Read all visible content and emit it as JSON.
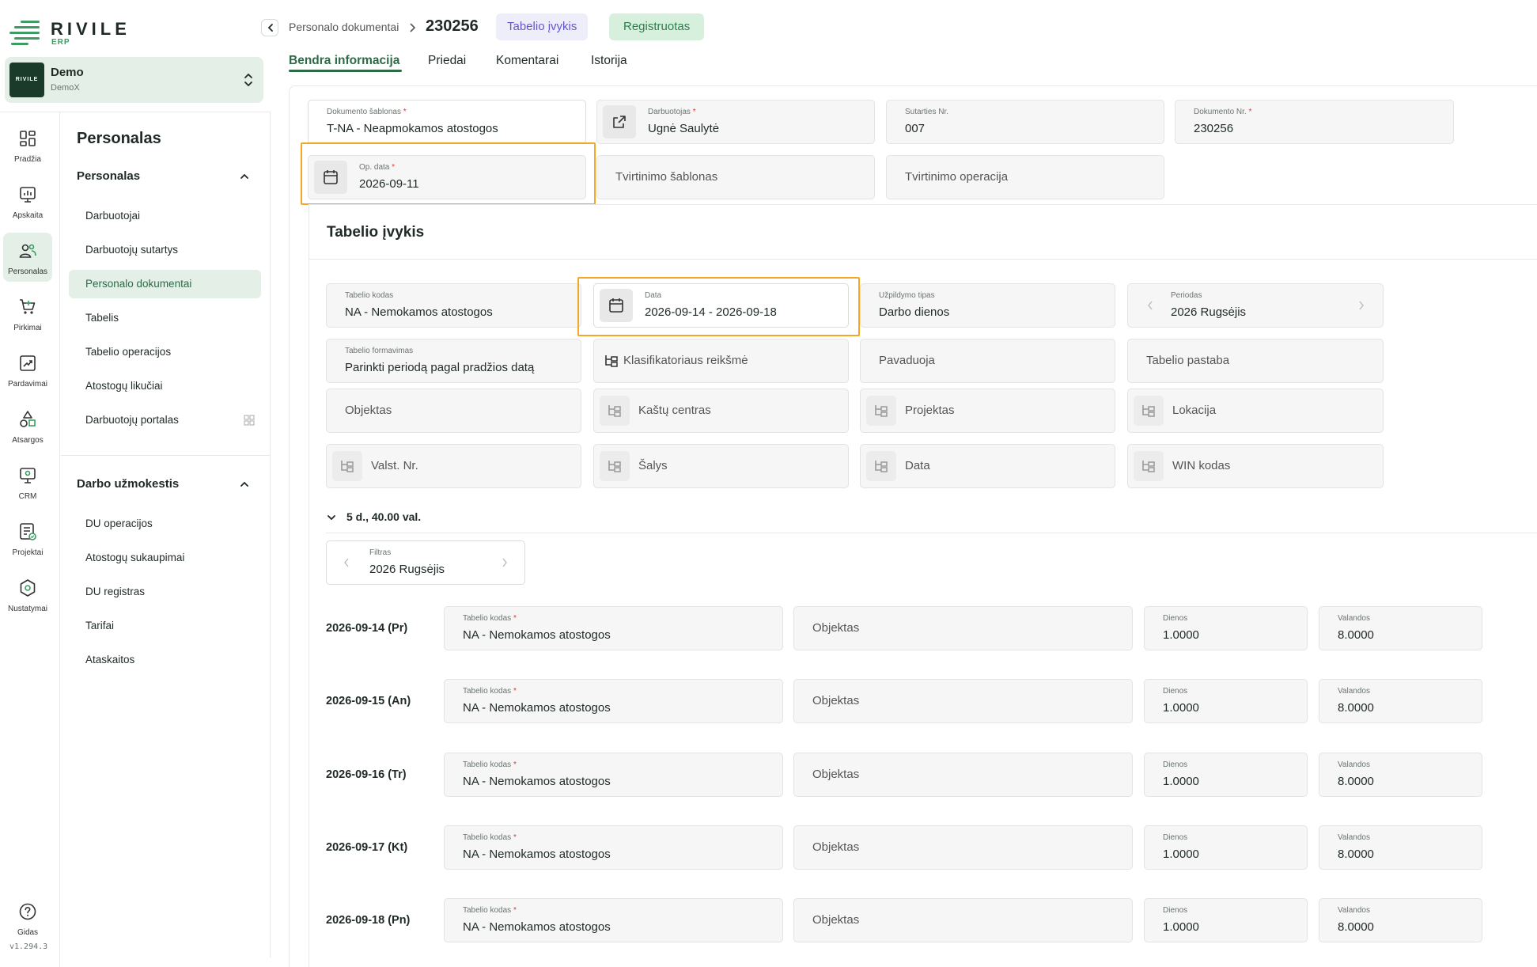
{
  "brand": {
    "name": "RIVILE",
    "sub": "ERP"
  },
  "company": {
    "name": "Demo",
    "sub": "DemoX",
    "logo_text": "RIVILE"
  },
  "rail": [
    {
      "label": "Pradžia",
      "icon": "dashboard-icon"
    },
    {
      "label": "Apskaita",
      "icon": "chart-icon"
    },
    {
      "label": "Personalas",
      "icon": "people-icon"
    },
    {
      "label": "Pirkimai",
      "icon": "cart-icon"
    },
    {
      "label": "Pardavimai",
      "icon": "sales-icon"
    },
    {
      "label": "Atsargos",
      "icon": "shapes-icon"
    },
    {
      "label": "CRM",
      "icon": "crm-icon"
    },
    {
      "label": "Projektai",
      "icon": "project-icon"
    },
    {
      "label": "Nustatymai",
      "icon": "gear-icon"
    }
  ],
  "help": {
    "label": "Gidas"
  },
  "version": "v1.294.3",
  "nav": {
    "title": "Personalas",
    "sections": [
      {
        "title": "Personalas",
        "items": [
          "Darbuotojai",
          "Darbuotojų sutartys",
          "Personalo dokumentai",
          "Tabelis",
          "Tabelio operacijos",
          "Atostogų likučiai",
          "Darbuotojų portalas"
        ]
      },
      {
        "title": "Darbo užmokestis",
        "items": [
          "DU operacijos",
          "Atostogų sukaupimai",
          "DU registras",
          "Tarifai",
          "Ataskaitos"
        ]
      }
    ]
  },
  "header": {
    "breadcrumb": "Personalo dokumentai",
    "doc_no": "230256",
    "type_tag": "Tabelio įvykis",
    "status_tag": "Registruotas"
  },
  "tabs": [
    "Bendra informacija",
    "Priedai",
    "Komentarai",
    "Istorija"
  ],
  "doc": {
    "template": {
      "label": "Dokumento šablonas",
      "value": "T-NA - Neapmokamos atostogos"
    },
    "employee": {
      "label": "Darbuotojas",
      "value": "Ugnė Saulytė"
    },
    "contract": {
      "label": "Sutarties Nr.",
      "value": "007"
    },
    "doc_no": {
      "label": "Dokumento Nr.",
      "value": "230256"
    },
    "op_date": {
      "label": "Op. data",
      "value": "2026-09-11"
    },
    "approval_template": {
      "placeholder": "Tvirtinimo šablonas"
    },
    "approval_operation": {
      "placeholder": "Tvirtinimo operacija"
    }
  },
  "event": {
    "title": "Tabelio įvykis",
    "code": {
      "label": "Tabelio kodas",
      "value": "NA - Nemokamos atostogos"
    },
    "date": {
      "label": "Data",
      "value": "2026-09-14 - 2026-09-18"
    },
    "fill_type": {
      "label": "Užpildymo tipas",
      "value": "Darbo dienos"
    },
    "period": {
      "label": "Periodas",
      "value": "2026 Rugsėjis"
    },
    "formation": {
      "label": "Tabelio formavimas",
      "value": "Parinkti periodą pagal pradžios datą"
    },
    "placeholders": {
      "classifier": "Klasifikatoriaus reikšmė",
      "replaces": "Pavaduoja",
      "note": "Tabelio pastaba",
      "object": "Objektas",
      "cost_center": "Kaštų centras",
      "project": "Projektas",
      "location": "Lokacija",
      "plate": "Valst. Nr.",
      "countries": "Šalys",
      "date": "Data",
      "win": "WIN kodas"
    }
  },
  "summary": "5 d., 40.00 val.",
  "filter": {
    "label": "Filtras",
    "value": "2026 Rugsėjis"
  },
  "rows": [
    {
      "day": "2026-09-14 (Pr)",
      "code": "NA - Nemokamos atostogos",
      "object": "Objektas",
      "days": "1.0000",
      "hours": "8.0000"
    },
    {
      "day": "2026-09-15 (An)",
      "code": "NA - Nemokamos atostogos",
      "object": "Objektas",
      "days": "1.0000",
      "hours": "8.0000"
    },
    {
      "day": "2026-09-16 (Tr)",
      "code": "NA - Nemokamos atostogos",
      "object": "Objektas",
      "days": "1.0000",
      "hours": "8.0000"
    },
    {
      "day": "2026-09-17 (Kt)",
      "code": "NA - Nemokamos atostogos",
      "object": "Objektas",
      "days": "1.0000",
      "hours": "8.0000"
    },
    {
      "day": "2026-09-18 (Pn)",
      "code": "NA - Nemokamos atostogos",
      "object": "Objektas",
      "days": "1.0000",
      "hours": "8.0000"
    }
  ],
  "row_labels": {
    "code": "Tabelio kodas",
    "days": "Dienos",
    "hours": "Valandos"
  },
  "colors": {
    "accent": "#2e6a47",
    "brand_green": "#3e9b63",
    "highlight": "#f5a623",
    "tag_purple": "#6356c9",
    "tag_green_bg": "#d7f0dd"
  }
}
